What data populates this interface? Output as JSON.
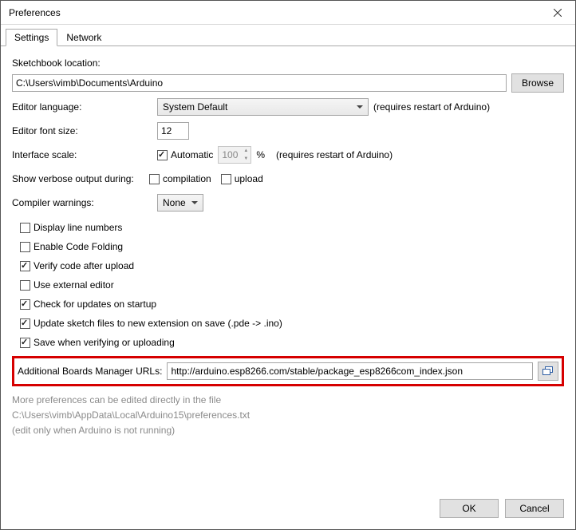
{
  "window": {
    "title": "Preferences"
  },
  "tabs": {
    "settings": "Settings",
    "network": "Network"
  },
  "sketchbook": {
    "label": "Sketchbook location:",
    "value": "C:\\Users\\vimb\\Documents\\Arduino",
    "browse": "Browse"
  },
  "language": {
    "label": "Editor language:",
    "value": "System Default",
    "hint": "(requires restart of Arduino)"
  },
  "fontsize": {
    "label": "Editor font size:",
    "value": "12"
  },
  "scale": {
    "label": "Interface scale:",
    "auto_label": "Automatic",
    "value": "100",
    "unit": "%",
    "hint": "(requires restart of Arduino)"
  },
  "verbose": {
    "label": "Show verbose output during:",
    "compilation": "compilation",
    "upload": "upload"
  },
  "warnings": {
    "label": "Compiler warnings:",
    "value": "None"
  },
  "checks": {
    "display_line_numbers": "Display line numbers",
    "enable_code_folding": "Enable Code Folding",
    "verify_after_upload": "Verify code after upload",
    "external_editor": "Use external editor",
    "check_updates": "Check for updates on startup",
    "update_sketch_ext": "Update sketch files to new extension on save (.pde -> .ino)",
    "save_on_verify": "Save when verifying or uploading"
  },
  "boards_urls": {
    "label": "Additional Boards Manager URLs:",
    "value": "http://arduino.esp8266.com/stable/package_esp8266com_index.json"
  },
  "more_prefs": {
    "line1": "More preferences can be edited directly in the file",
    "path": "C:\\Users\\vimb\\AppData\\Local\\Arduino15\\preferences.txt",
    "line2": "(edit only when Arduino is not running)"
  },
  "buttons": {
    "ok": "OK",
    "cancel": "Cancel"
  }
}
